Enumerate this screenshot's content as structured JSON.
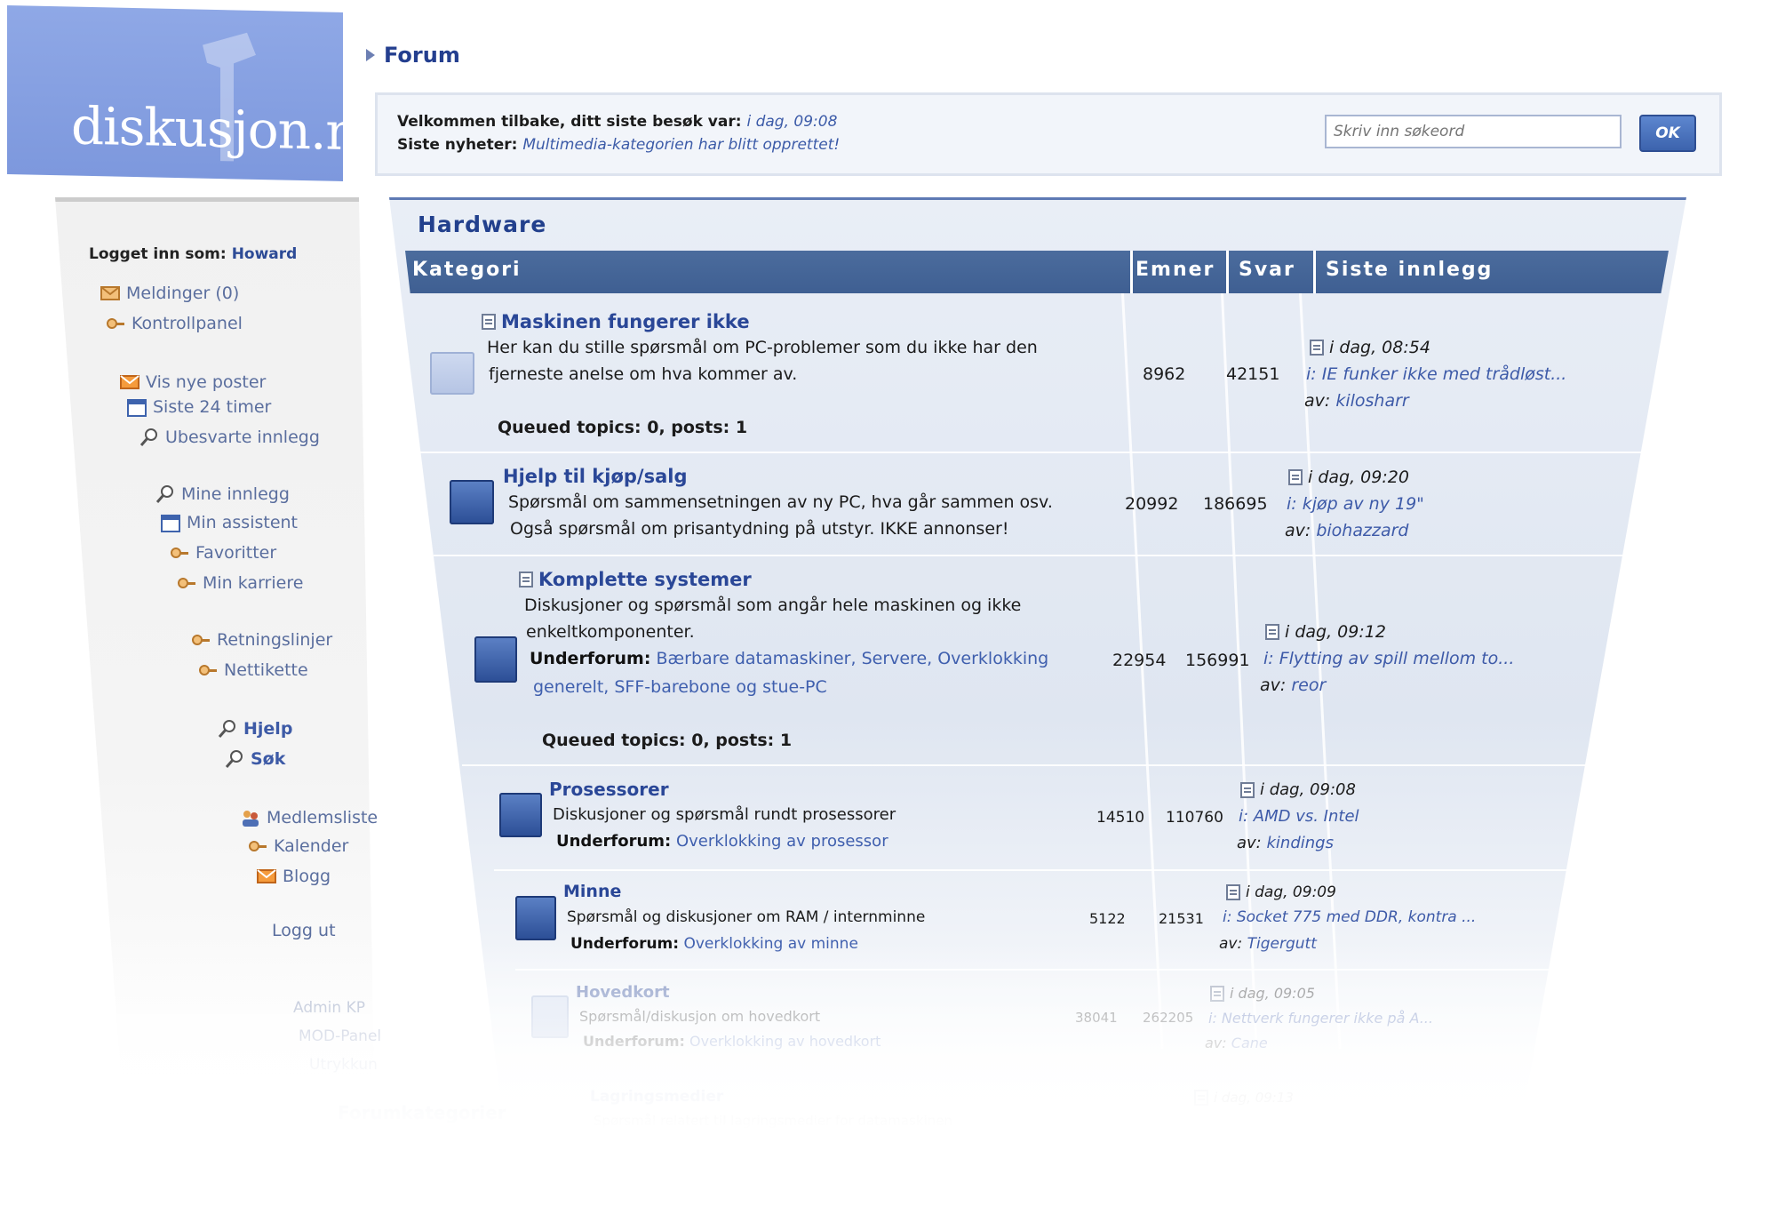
{
  "logo": {
    "text": "diskusjon.no"
  },
  "breadcrumb": {
    "label": "Forum"
  },
  "welcome": {
    "line1_label": "Velkommen tilbake, ditt siste besøk var:",
    "line1_value": "i dag, 09:08",
    "line2_label": "Siste nyheter:",
    "line2_value": "Multimedia-kategorien har blitt opprettet!"
  },
  "search": {
    "placeholder": "Skriv inn søkeord",
    "button": "OK"
  },
  "sidebar": {
    "login_label": "Logget inn som:",
    "login_user": "Howard",
    "items": [
      "Meldinger (0)",
      "Kontrollpanel",
      "Vis nye poster",
      "Siste 24 timer",
      "Ubesvarte innlegg",
      "Mine innlegg",
      "Min assistent",
      "Favoritter",
      "Min karriere",
      "Retningslinjer",
      "Nettikette",
      "Hjelp",
      "Søk",
      "Medlemsliste",
      "Kalender",
      "Blogg",
      "Logg ut",
      "Admin KP",
      "MOD-Panel",
      "Utrykkun",
      "Forumkategorier"
    ]
  },
  "panel": {
    "title": "Hardware",
    "columns": [
      "Kategori",
      "Emner",
      "Svar",
      "Siste innlegg"
    ]
  },
  "forums": [
    {
      "title": "Maskinen fungerer ikke",
      "desc1": "Her kan du stille spørsmål om PC-problemer som du ikke har den",
      "desc2": "fjerneste anelse om hva kommer av.",
      "queued": "Queued topics: 0, posts: 1",
      "topics": "8962",
      "replies": "42151",
      "last_time": "i dag, 08:54",
      "last_thread": "i: IE funker ikke med trådløst...",
      "last_by_label": "av:",
      "last_by": "kilosharr"
    },
    {
      "title": "Hjelp til kjøp/salg",
      "desc1": "Spørsmål om sammensetningen av ny PC, hva går sammen osv.",
      "desc2": "Også spørsmål om prisantydning på utstyr. IKKE annonser!",
      "topics": "20992",
      "replies": "186695",
      "last_time": "i dag, 09:20",
      "last_thread": "i: kjøp av ny 19\"",
      "last_by_label": "av:",
      "last_by": "biohazzard"
    },
    {
      "title": "Komplette systemer",
      "desc1": "Diskusjoner og spørsmål som angår hele maskinen og ikke",
      "desc2": "enkeltkomponenter.",
      "sub_label": "Underforum:",
      "sub_links1": "Bærbare datamaskiner, Servere, Overklokking",
      "sub_links2": "generelt, SFF-barebone og stue-PC",
      "queued": "Queued topics: 0, posts: 1",
      "topics": "22954",
      "replies": "156991",
      "last_time": "i dag, 09:12",
      "last_thread": "i: Flytting av spill mellom to...",
      "last_by_label": "av:",
      "last_by": "reor"
    },
    {
      "title": "Prosessorer",
      "desc1": "Diskusjoner og spørsmål rundt prosessorer",
      "sub_label": "Underforum:",
      "sub_links1": "Overklokking av prosessor",
      "topics": "14510",
      "replies": "110760",
      "last_time": "i dag, 09:08",
      "last_thread": "i: AMD vs. Intel",
      "last_by_label": "av:",
      "last_by": "kindings"
    },
    {
      "title": "Minne",
      "desc1": "Spørsmål og diskusjoner om RAM / internminne",
      "sub_label": "Underforum:",
      "sub_links1": "Overklokking av minne",
      "topics": "5122",
      "replies": "21531",
      "last_time": "i dag, 09:09",
      "last_thread": "i: Socket 775 med DDR, kontra ...",
      "last_by_label": "av:",
      "last_by": "Tigergutt"
    },
    {
      "title": "Hovedkort",
      "desc1": "Spørsmål/diskusjon om hovedkort",
      "sub_label": "Underforum:",
      "sub_links1": "Overklokking av hovedkort",
      "topics": "38041",
      "replies": "262205",
      "last_time": "i dag, 09:05",
      "last_thread": "i: Nettverk fungerer ikke på A...",
      "last_by_label": "av:",
      "last_by": "Cane"
    },
    {
      "title": "Lagringsmedier",
      "desc1": "Spørsmål relatert til lagringsmedier for datamaskinen",
      "topics": "",
      "replies": "",
      "last_time": "i dag, 09:13",
      "last_thread": "",
      "last_by_label": "",
      "last_by": ""
    }
  ],
  "colors": {
    "logo_bg": "#8fa8e6",
    "header_bar": "#45669a",
    "link": "#3d5aa8",
    "title": "#2a4797",
    "panel_bg": "#e3e9f3"
  }
}
